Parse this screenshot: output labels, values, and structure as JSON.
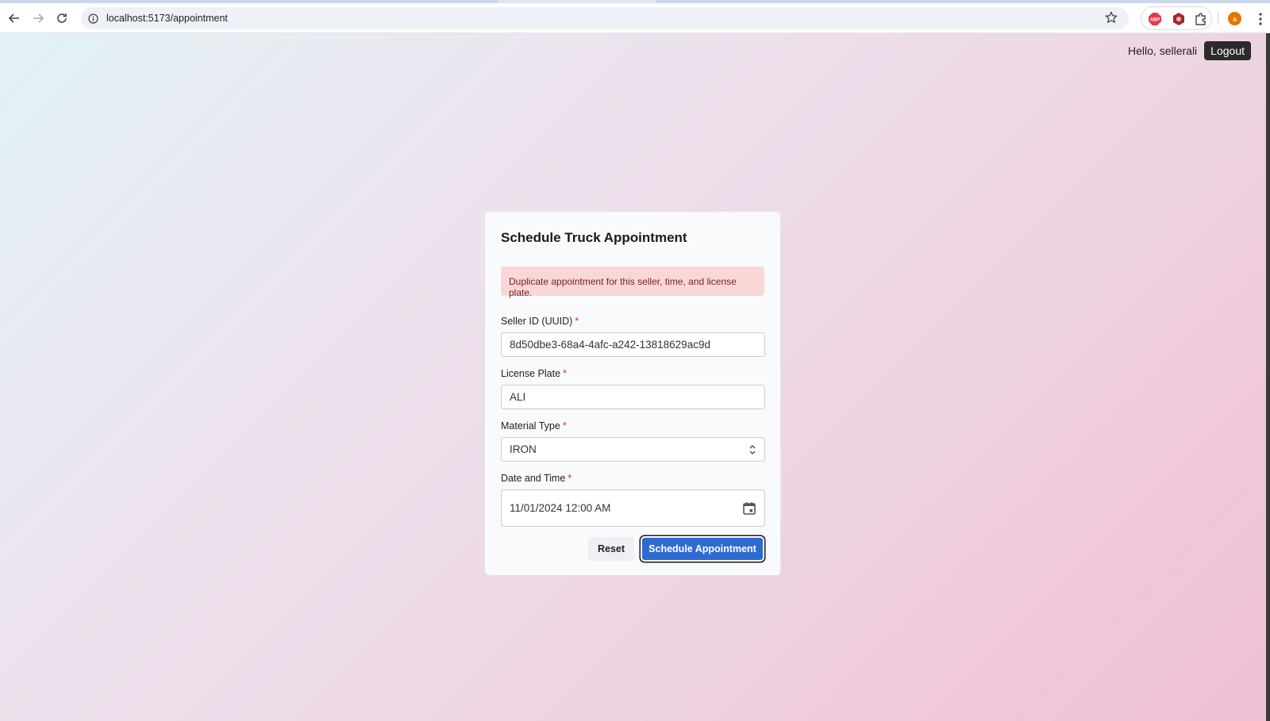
{
  "browser": {
    "url": "localhost:5173/appointment",
    "avatar_letter": "a",
    "ext_abp_label": "ABP"
  },
  "header": {
    "greeting": "Hello, sellerali",
    "logout_label": "Logout"
  },
  "form": {
    "title": "Schedule Truck Appointment",
    "error_message": "Duplicate appointment for this seller, time, and license plate.",
    "required_mark": "*",
    "fields": [
      {
        "label": "Seller ID (UUID)",
        "value": "8d50dbe3-68a4-4afc-a242-13818629ac9d"
      },
      {
        "label": "License Plate",
        "value": "ALI"
      },
      {
        "label": "Material Type",
        "value": "IRON"
      },
      {
        "label": "Date and Time",
        "value": "11/01/2024 12:00 AM"
      }
    ],
    "reset_label": "Reset",
    "submit_label": "Schedule Appointment"
  },
  "colors": {
    "primary": "#2d6bd3",
    "error_bg": "#f9d7d7",
    "error_text": "#7a1f1f",
    "required": "#d93025"
  }
}
